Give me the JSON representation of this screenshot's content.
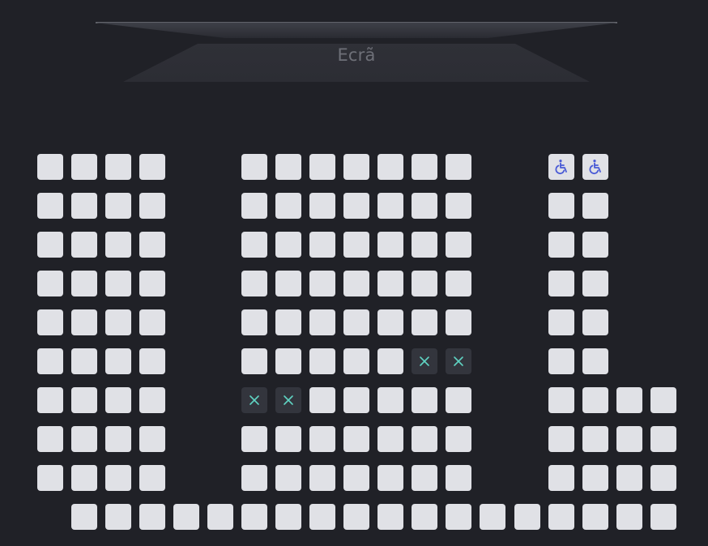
{
  "screen": {
    "label": "Ecrã"
  },
  "colors": {
    "background": "#202127",
    "seat_available": "#e0e1e6",
    "seat_occupied": "#33353d",
    "occupied_mark": "#5fd3c3",
    "wheelchair_icon": "#4a5bd6"
  },
  "legend_icons": {
    "occupied": "x-icon",
    "accessible": "wheelchair-icon"
  },
  "rows": [
    {
      "row": 1,
      "left": [
        "available",
        "available",
        "available",
        "available"
      ],
      "center": [
        "available",
        "available",
        "available",
        "available",
        "available",
        "available",
        "available"
      ],
      "right": [
        "wheelchair",
        "wheelchair"
      ]
    },
    {
      "row": 2,
      "left": [
        "available",
        "available",
        "available",
        "available"
      ],
      "center": [
        "available",
        "available",
        "available",
        "available",
        "available",
        "available",
        "available"
      ],
      "right": [
        "available",
        "available"
      ]
    },
    {
      "row": 3,
      "left": [
        "available",
        "available",
        "available",
        "available"
      ],
      "center": [
        "available",
        "available",
        "available",
        "available",
        "available",
        "available",
        "available"
      ],
      "right": [
        "available",
        "available"
      ]
    },
    {
      "row": 4,
      "left": [
        "available",
        "available",
        "available",
        "available"
      ],
      "center": [
        "available",
        "available",
        "available",
        "available",
        "available",
        "available",
        "available"
      ],
      "right": [
        "available",
        "available"
      ]
    },
    {
      "row": 5,
      "left": [
        "available",
        "available",
        "available",
        "available"
      ],
      "center": [
        "available",
        "available",
        "available",
        "available",
        "available",
        "available",
        "available"
      ],
      "right": [
        "available",
        "available"
      ]
    },
    {
      "row": 6,
      "left": [
        "available",
        "available",
        "available",
        "available"
      ],
      "center": [
        "available",
        "available",
        "available",
        "available",
        "available",
        "occupied",
        "occupied"
      ],
      "right": [
        "available",
        "available"
      ]
    },
    {
      "row": 7,
      "left": [
        "available",
        "available",
        "available",
        "available"
      ],
      "center": [
        "occupied",
        "occupied",
        "available",
        "available",
        "available",
        "available",
        "available"
      ],
      "right": [
        "available",
        "available",
        "available",
        "available"
      ]
    },
    {
      "row": 8,
      "left": [
        "available",
        "available",
        "available",
        "available"
      ],
      "center": [
        "available",
        "available",
        "available",
        "available",
        "available",
        "available",
        "available"
      ],
      "right": [
        "available",
        "available",
        "available",
        "available"
      ]
    },
    {
      "row": 9,
      "left": [
        "available",
        "available",
        "available",
        "available"
      ],
      "center": [
        "available",
        "available",
        "available",
        "available",
        "available",
        "available",
        "available"
      ],
      "right": [
        "available",
        "available",
        "available",
        "available"
      ]
    },
    {
      "row": 10,
      "back": [
        "available",
        "available",
        "available",
        "available",
        "available",
        "available",
        "available",
        "available",
        "available",
        "available",
        "available",
        "available",
        "available",
        "available",
        "available",
        "available",
        "available",
        "available"
      ]
    }
  ]
}
